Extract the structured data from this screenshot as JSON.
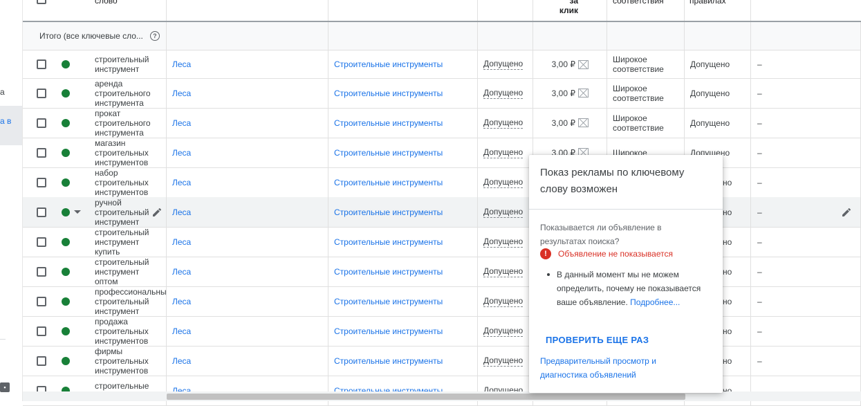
{
  "leftnav": {
    "item1": "а",
    "item2": "а в",
    "bottom": "..."
  },
  "header": {
    "keyword_label": "слово",
    "bid_label_1": "за",
    "bid_label_2": "клик",
    "match_label": "соответствия",
    "policy_label": "правилах"
  },
  "totals": {
    "label": "Итого (все ключевые сло...",
    "help_icon": "?"
  },
  "rows": [
    {
      "keyword": "строительный\nинструмент",
      "ad_group": "Леса",
      "campaign": "Строительные инструменты",
      "status": "Допущено",
      "bid": "3,00 ₽",
      "match": "Широкое\nсоответствие",
      "policy": "Допущено",
      "extra": "–"
    },
    {
      "keyword": "аренда\nстроительного\nинструмента",
      "ad_group": "Леса",
      "campaign": "Строительные инструменты",
      "status": "Допущено",
      "bid": "3,00 ₽",
      "match": "Широкое\nсоответствие",
      "policy": "Допущено",
      "extra": "–"
    },
    {
      "keyword": "прокат\nстроительного\nинструмента",
      "ad_group": "Леса",
      "campaign": "Строительные инструменты",
      "status": "Допущено",
      "bid": "3,00 ₽",
      "match": "Широкое\nсоответствие",
      "policy": "Допущено",
      "extra": "–"
    },
    {
      "keyword": "магазин\nстроительных\nинструментов",
      "ad_group": "Леса",
      "campaign": "Строительные инструменты",
      "status": "Допущено",
      "bid": "3,00 ₽",
      "match": "Широкое",
      "policy": "Допущено",
      "extra": "–"
    },
    {
      "keyword": "набор\nстроительных\nинструментов",
      "ad_group": "Леса",
      "campaign": "Строительные инструменты",
      "status": "Допущено",
      "bid": "",
      "match": "",
      "policy": "но",
      "extra": "–"
    },
    {
      "keyword": "ручной\nстроительный\nинструмент",
      "ad_group": "Леса",
      "campaign": "Строительные инструменты",
      "status": "Допущено",
      "bid": "",
      "match": "",
      "policy": "но",
      "extra": "–"
    },
    {
      "keyword": "строительный\nинструмент\nкупить",
      "ad_group": "Леса",
      "campaign": "Строительные инструменты",
      "status": "Допущено",
      "bid": "",
      "match": "",
      "policy": "но",
      "extra": "–"
    },
    {
      "keyword": "строительный\nинструмент\nоптом",
      "ad_group": "Леса",
      "campaign": "Строительные инструменты",
      "status": "Допущено",
      "bid": "",
      "match": "",
      "policy": "но",
      "extra": "–"
    },
    {
      "keyword": "профессиональны\nстроительный\nинструмент",
      "ad_group": "Леса",
      "campaign": "Строительные инструменты",
      "status": "Допущено",
      "bid": "",
      "match": "",
      "policy": "но",
      "extra": "–"
    },
    {
      "keyword": "продажа\nстроительных\nинструментов",
      "ad_group": "Леса",
      "campaign": "Строительные инструменты",
      "status": "Допущено",
      "bid": "",
      "match": "",
      "policy": "но",
      "extra": "–"
    },
    {
      "keyword": "фирмы\nстроительных\nинструментов",
      "ad_group": "Леса",
      "campaign": "Строительные инструменты",
      "status": "Допущено",
      "bid": "",
      "match": "",
      "policy": "но",
      "extra": "–"
    },
    {
      "keyword": "строительные\nинструменты",
      "ad_group": "Леса",
      "campaign": "Строительные инструменты",
      "status": "Допущено",
      "bid": "",
      "match": "",
      "policy": "но",
      "extra": ""
    }
  ],
  "popup": {
    "title": "Показ рекламы по ключевому слову возможен",
    "question": "Показывается ли объявление в результатах поиска?",
    "error_icon": "!",
    "error": "Объявление не показывается",
    "bullet": "В данный момент мы не можем определить, почему не показывается ваше объявление.",
    "more": "Подробнее...",
    "button": "ПРОВЕРИТЬ ЕЩЕ РАЗ",
    "link": "Предварительный просмотр и диагностика объявлений"
  },
  "colors": {
    "enabled_dot": "#188038",
    "link": "#1a73e8",
    "error": "#d93025"
  }
}
